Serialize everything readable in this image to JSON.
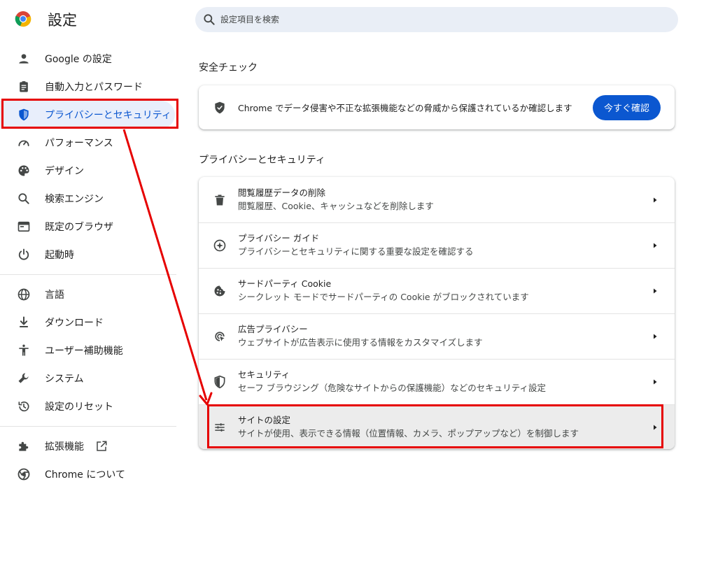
{
  "app": {
    "title": "設定"
  },
  "search": {
    "placeholder": "設定項目を検索"
  },
  "sidebar": {
    "items": [
      {
        "label": "Google の設定",
        "icon": "person-icon"
      },
      {
        "label": "自動入力とパスワード",
        "icon": "clipboard-icon"
      },
      {
        "label": "プライバシーとセキュリティ",
        "icon": "shield-icon",
        "active": true
      },
      {
        "label": "パフォーマンス",
        "icon": "speedometer-icon"
      },
      {
        "label": "デザイン",
        "icon": "palette-icon"
      },
      {
        "label": "検索エンジン",
        "icon": "search-icon"
      },
      {
        "label": "既定のブラウザ",
        "icon": "browser-icon"
      },
      {
        "label": "起動時",
        "icon": "power-icon"
      }
    ],
    "items2": [
      {
        "label": "言語",
        "icon": "globe-icon"
      },
      {
        "label": "ダウンロード",
        "icon": "download-icon"
      },
      {
        "label": "ユーザー補助機能",
        "icon": "accessibility-icon"
      },
      {
        "label": "システム",
        "icon": "wrench-icon"
      },
      {
        "label": "設定のリセット",
        "icon": "reset-icon"
      }
    ],
    "items3": [
      {
        "label": "拡張機能",
        "icon": "puzzle-icon"
      },
      {
        "label": "Chrome について",
        "icon": "chrome-icon"
      }
    ]
  },
  "safety": {
    "section_title": "安全チェック",
    "text": "Chrome でデータ侵害や不正な拡張機能などの脅威から保護されているか確認します",
    "button_label": "今すぐ確認"
  },
  "privacy": {
    "section_title": "プライバシーとセキュリティ",
    "rows": [
      {
        "title": "閲覧履歴データの削除",
        "subtitle": "閲覧履歴、Cookie、キャッシュなどを削除します",
        "icon": "trash-icon"
      },
      {
        "title": "プライバシー ガイド",
        "subtitle": "プライバシーとセキュリティに関する重要な設定を確認する",
        "icon": "compass-icon"
      },
      {
        "title": "サードパーティ Cookie",
        "subtitle": "シークレット モードでサードパーティの Cookie がブロックされています",
        "icon": "cookie-icon"
      },
      {
        "title": "広告プライバシー",
        "subtitle": "ウェブサイトが広告表示に使用する情報をカスタマイズします",
        "icon": "ad-privacy-icon"
      },
      {
        "title": "セキュリティ",
        "subtitle": "セーフ ブラウジング（危険なサイトからの保護機能）などのセキュリティ設定",
        "icon": "security-shield-icon"
      },
      {
        "title": "サイトの設定",
        "subtitle": "サイトが使用、表示できる情報（位置情報、カメラ、ポップアップなど）を制御します",
        "icon": "tune-icon",
        "highlighted": true
      }
    ]
  },
  "colors": {
    "accent": "#0b57d0",
    "active_bg": "#e8eefb",
    "annotation": "#e60000"
  }
}
